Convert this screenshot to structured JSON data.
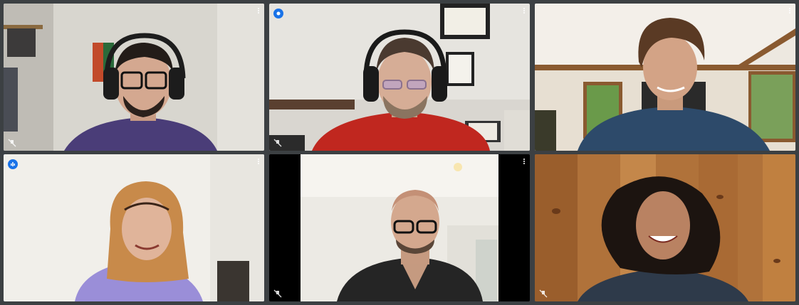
{
  "meeting": {
    "layout": "grid-3x2",
    "active_speaker_color": "#1a73e8",
    "tiles": [
      {
        "position": "top-left",
        "muted": true,
        "speaking": false,
        "icon": "mic-off-icon"
      },
      {
        "position": "top-center",
        "muted": false,
        "speaking": true,
        "icon": "audio-level-icon"
      },
      {
        "position": "top-right",
        "muted": false,
        "speaking": false,
        "icon": "more-options-icon"
      },
      {
        "position": "bottom-left",
        "muted": false,
        "speaking": true,
        "icon": "audio-level-icon"
      },
      {
        "position": "bottom-center",
        "muted": true,
        "speaking": false,
        "icon": "mic-off-icon"
      },
      {
        "position": "bottom-right",
        "muted": true,
        "speaking": false,
        "icon": "mic-off-icon"
      }
    ]
  }
}
